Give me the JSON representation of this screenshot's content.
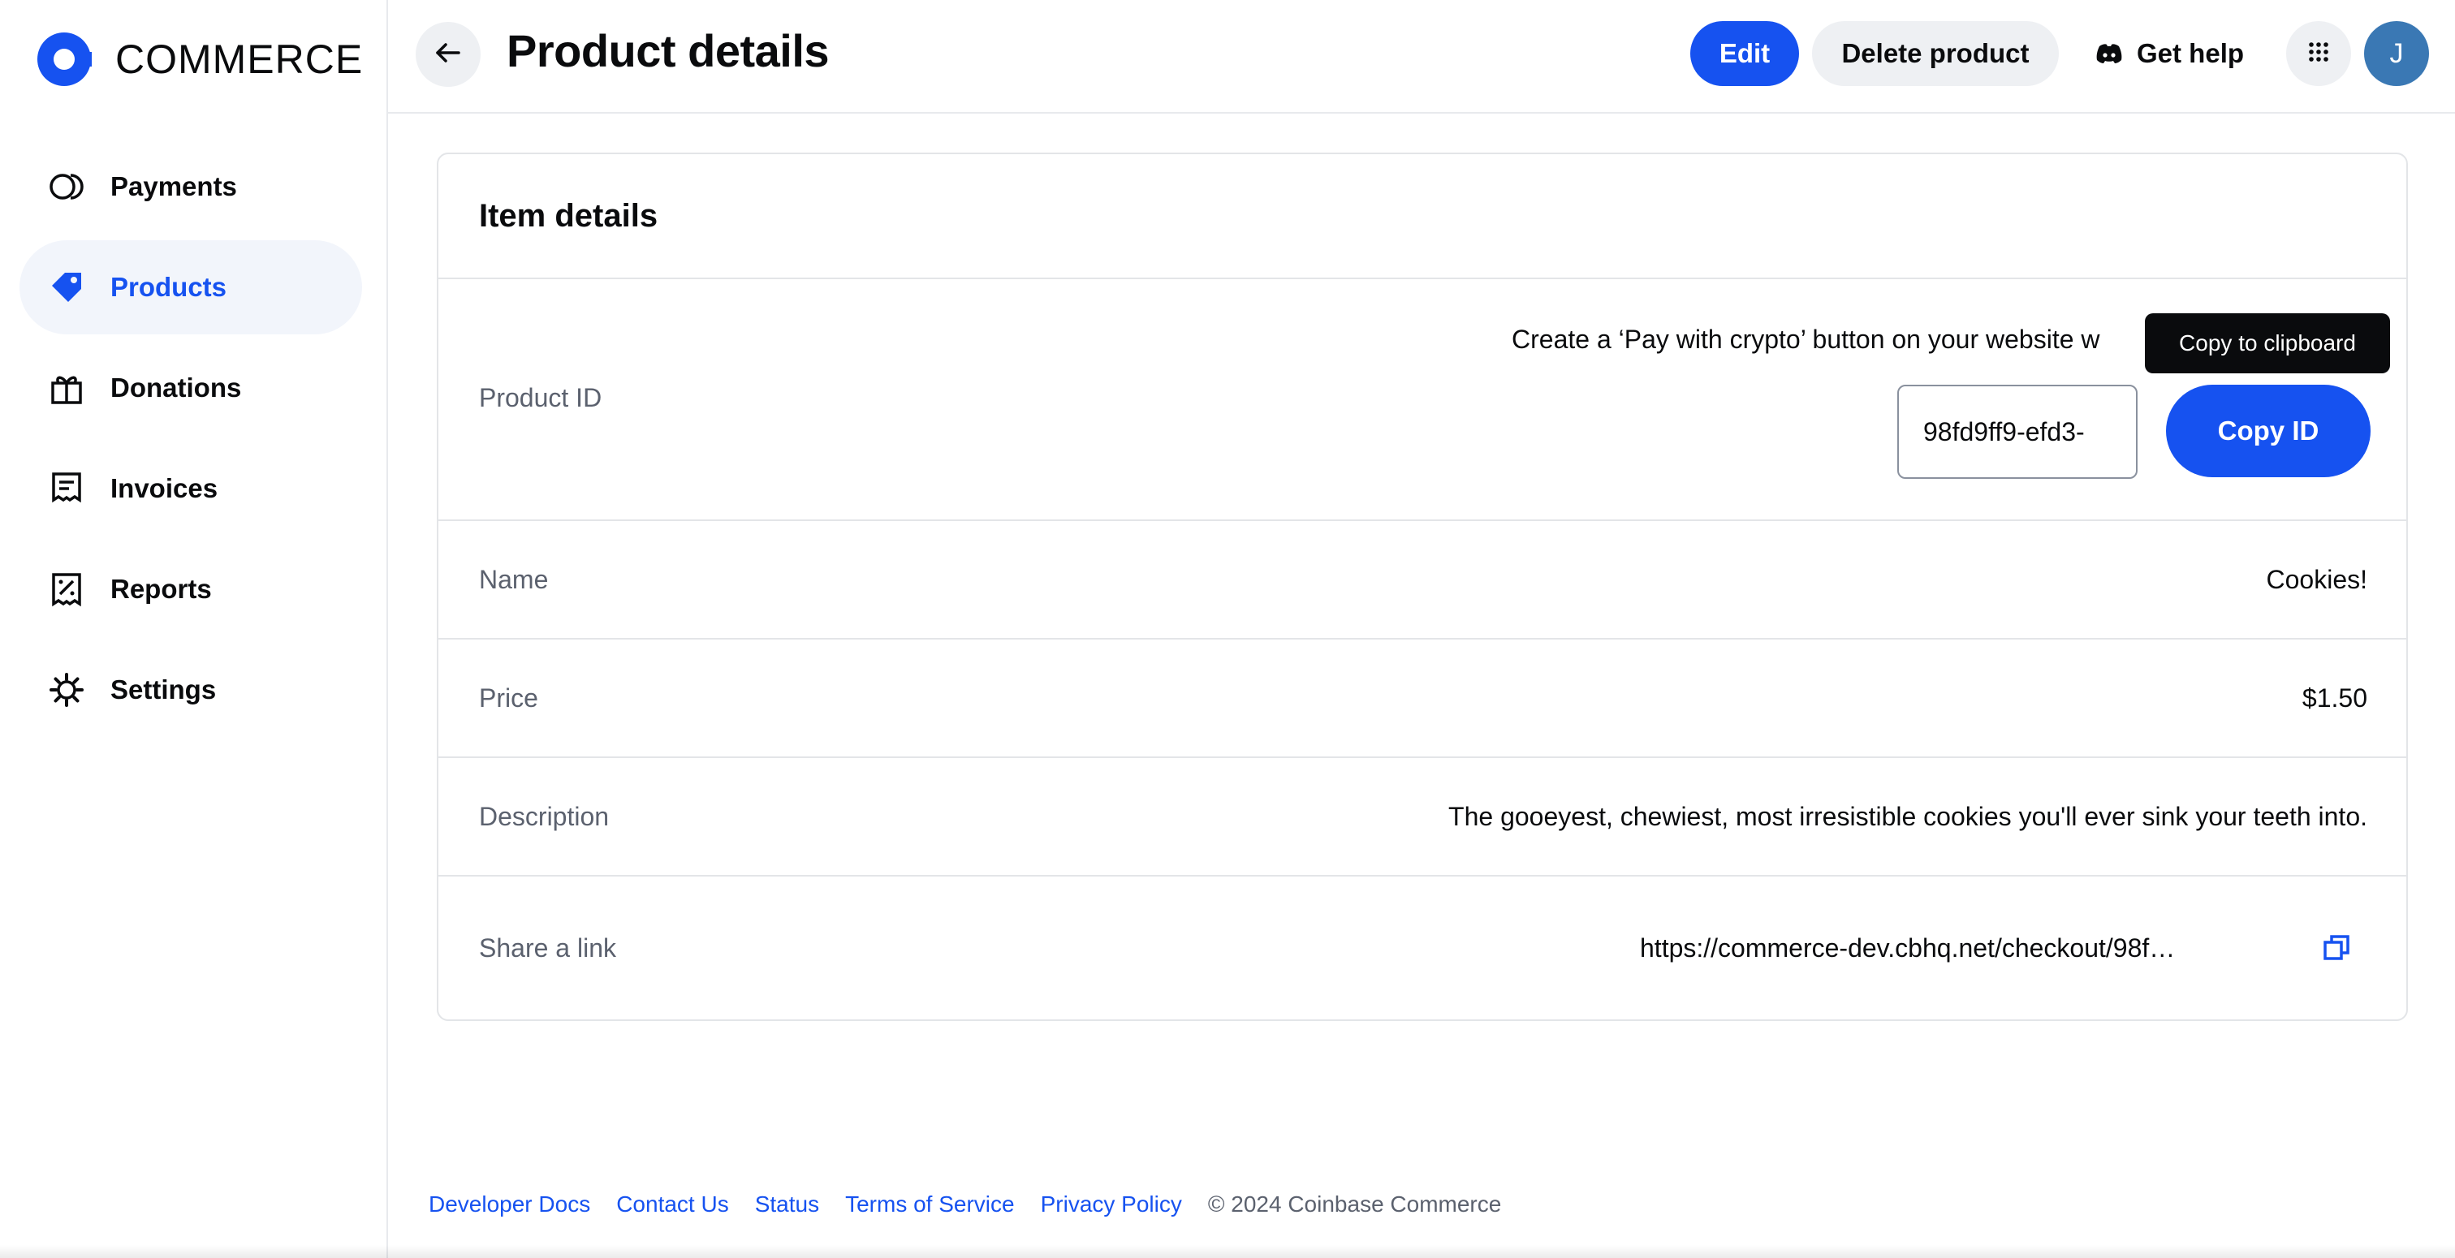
{
  "app": {
    "logo_text": "COMMERCE"
  },
  "sidebar": {
    "items": [
      {
        "label": "Payments",
        "icon": "payments-icon",
        "active": false
      },
      {
        "label": "Products",
        "icon": "tag-icon",
        "active": true
      },
      {
        "label": "Donations",
        "icon": "gift-icon",
        "active": false
      },
      {
        "label": "Invoices",
        "icon": "receipt-icon",
        "active": false
      },
      {
        "label": "Reports",
        "icon": "percent-report-icon",
        "active": false
      },
      {
        "label": "Settings",
        "icon": "gear-icon",
        "active": false
      }
    ]
  },
  "header": {
    "title": "Product details",
    "edit_label": "Edit",
    "delete_label": "Delete product",
    "help_label": "Get help",
    "avatar_initial": "J"
  },
  "card": {
    "title": "Item details",
    "product_id": {
      "label": "Product ID",
      "hint": "Create a ‘Pay with crypto’ button on your website w",
      "value": "98fd9ff9-efd3-",
      "copy_button": "Copy ID",
      "tooltip": "Copy to clipboard"
    },
    "name": {
      "label": "Name",
      "value": "Cookies!"
    },
    "price": {
      "label": "Price",
      "value": "$1.50"
    },
    "description": {
      "label": "Description",
      "value": "The gooeyest, chewiest, most irresistible cookies you'll ever sink your teeth into."
    },
    "share": {
      "label": "Share a link",
      "value": "https://commerce-dev.cbhq.net/checkout/98fd9ff..."
    }
  },
  "footer": {
    "links": [
      "Developer Docs",
      "Contact Us",
      "Status",
      "Terms of Service",
      "Privacy Policy"
    ],
    "copyright": "© 2024 Coinbase Commerce"
  },
  "colors": {
    "accent": "#1652f0",
    "text": "#0a0b0d",
    "muted": "#5b616e",
    "avatar": "#3a78b4"
  }
}
